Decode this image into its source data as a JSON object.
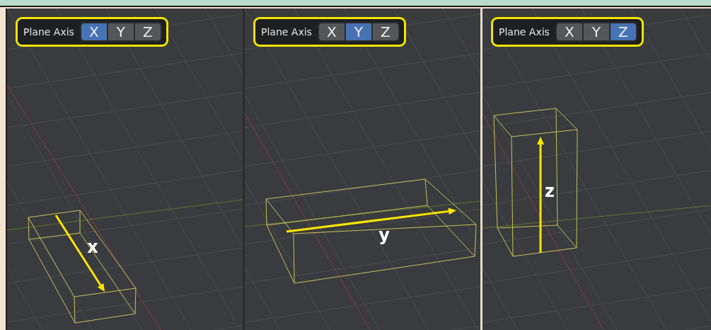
{
  "panels": [
    {
      "plane_axis": {
        "label": "Plane Axis",
        "options": [
          {
            "label": "X",
            "selected": true
          },
          {
            "label": "Y",
            "selected": false
          },
          {
            "label": "Z",
            "selected": false
          }
        ]
      },
      "axis_label": "x"
    },
    {
      "plane_axis": {
        "label": "Plane Axis",
        "options": [
          {
            "label": "X",
            "selected": false
          },
          {
            "label": "Y",
            "selected": true
          },
          {
            "label": "Z",
            "selected": false
          }
        ]
      },
      "axis_label": "y"
    },
    {
      "plane_axis": {
        "label": "Plane Axis",
        "options": [
          {
            "label": "X",
            "selected": false
          },
          {
            "label": "Y",
            "selected": false
          },
          {
            "label": "Z",
            "selected": true
          }
        ]
      },
      "axis_label": "z"
    }
  ]
}
